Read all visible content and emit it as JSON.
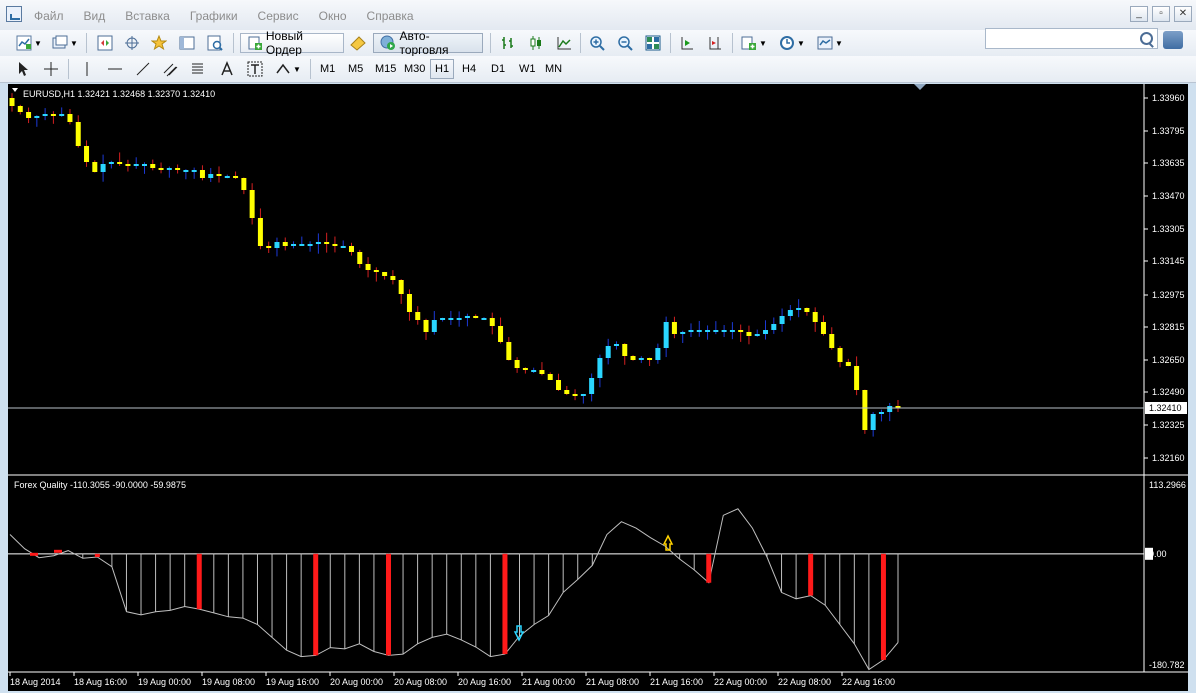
{
  "menu": {
    "items": [
      "Файл",
      "Вид",
      "Вставка",
      "Графики",
      "Сервис",
      "Окно",
      "Справка"
    ]
  },
  "toolbar": {
    "new_order_label": "Новый Ордер",
    "autotrading_label": "Авто-торговля"
  },
  "timeframes": [
    "M1",
    "M5",
    "M15",
    "M30",
    "H1",
    "H4",
    "D1",
    "W1",
    "MN"
  ],
  "active_timeframe": "H1",
  "chart": {
    "header": "EURUSD,H1  1.32421 1.32468 1.32370 1.32410",
    "current_price": "1.32410",
    "price_ticks": [
      "1.33960",
      "1.33795",
      "1.33635",
      "1.33470",
      "1.33305",
      "1.33145",
      "1.32975",
      "1.32815",
      "1.32650",
      "1.32490",
      "1.32325",
      "1.32160"
    ],
    "time_ticks": [
      "18 Aug 2014",
      "18 Aug 16:00",
      "19 Aug 00:00",
      "19 Aug 08:00",
      "19 Aug 16:00",
      "20 Aug 00:00",
      "20 Aug 08:00",
      "20 Aug 16:00",
      "21 Aug 00:00",
      "21 Aug 08:00",
      "21 Aug 16:00",
      "22 Aug 00:00",
      "22 Aug 08:00",
      "22 Aug 16:00"
    ],
    "colors": {
      "bull": "#2ad6ff",
      "bear": "#ffff00",
      "wick_bull": "#1c3ad8",
      "wick_bear": "#d42020",
      "grid": "#ffffff",
      "bg": "#000000"
    },
    "close_path": [
      1.3392,
      1.3389,
      1.3386,
      1.3387,
      1.3388,
      1.3387,
      1.3388,
      1.3384,
      1.3372,
      1.3364,
      1.3359,
      1.3363,
      1.3364,
      1.3363,
      1.3362,
      1.3363,
      1.3363,
      1.3361,
      1.336,
      1.3361,
      1.336,
      1.336,
      1.336,
      1.3356,
      1.3358,
      1.3357,
      1.3357,
      1.3356,
      1.335,
      1.3336,
      1.3322,
      1.3321,
      1.3324,
      1.3322,
      1.3323,
      1.3323,
      1.3323,
      1.3324,
      1.3323,
      1.3322,
      1.3322,
      1.3319,
      1.3313,
      1.331,
      1.3309,
      1.3307,
      1.3305,
      1.3298,
      1.3289,
      1.3285,
      1.3279,
      1.3285,
      1.3286,
      1.3286,
      1.3286,
      1.3287,
      1.3286,
      1.3286,
      1.3282,
      1.3274,
      1.3265,
      1.3261,
      1.326,
      1.326,
      1.3258,
      1.3255,
      1.325,
      1.3248,
      1.3247,
      1.3248,
      1.3256,
      1.3266,
      1.3272,
      1.3273,
      1.3267,
      1.3265,
      1.3266,
      1.3265,
      1.3271,
      1.3284,
      1.3278,
      1.3279,
      1.328,
      1.328,
      1.328,
      1.328,
      1.328,
      1.328,
      1.3279,
      1.3277,
      1.3278,
      1.328,
      1.3283,
      1.3287,
      1.329,
      1.3291,
      1.3289,
      1.3284,
      1.3278,
      1.3271,
      1.3264,
      1.3262,
      1.325,
      1.323,
      1.3238,
      1.3239,
      1.3242,
      1.3241
    ],
    "indicator": {
      "label": "Forex Quality -110.3055 -90.0000 -59.9875",
      "max_label": "113.2966",
      "zero_label": "0.00",
      "min_label": "-180.782",
      "max": 113.2966,
      "min": -180.782,
      "line_color": "#bfbfbf",
      "signal_color": "#ff1a1a",
      "values": [
        30,
        8,
        -6,
        -3,
        5,
        -7,
        -5,
        -20,
        -90,
        -95,
        -90,
        -88,
        -82,
        -86,
        -92,
        -98,
        -100,
        -110,
        -130,
        -150,
        -160,
        -158,
        -146,
        -148,
        -140,
        -152,
        -158,
        -156,
        -140,
        -130,
        -125,
        -134,
        -145,
        -160,
        -156,
        -128,
        -110,
        -96,
        -60,
        -40,
        -18,
        30,
        50,
        40,
        25,
        12,
        -8,
        -25,
        -45,
        60,
        70,
        40,
        -5,
        -60,
        -70,
        -65,
        -80,
        -110,
        -140,
        -180,
        -165,
        -138
      ],
      "signal_indices": [
        6,
        13,
        21,
        26,
        34,
        41,
        48,
        55,
        60
      ]
    }
  }
}
